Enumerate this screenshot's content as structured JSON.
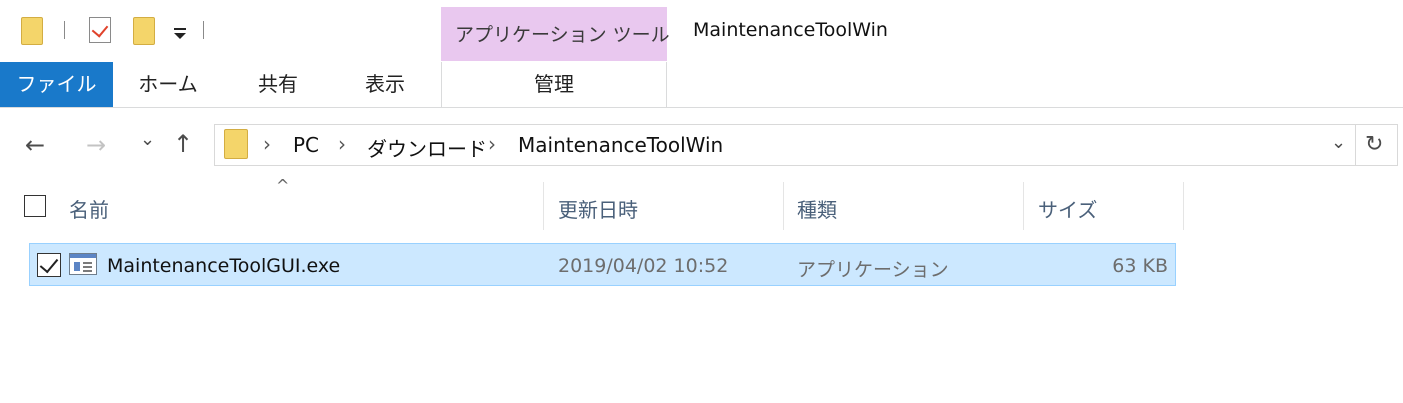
{
  "window": {
    "title": "MaintenanceToolWin",
    "tool_group_label": "アプリケーション ツール"
  },
  "quick_access": {
    "icons": [
      "folder-icon",
      "properties-icon",
      "new-folder-icon",
      "customize-menu-icon"
    ]
  },
  "ribbon": {
    "tabs": [
      {
        "label": "ファイル",
        "active": true
      },
      {
        "label": "ホーム"
      },
      {
        "label": "共有"
      },
      {
        "label": "表示"
      },
      {
        "label": "管理"
      }
    ]
  },
  "navigation": {
    "back_glyph": "←",
    "forward_glyph": "→",
    "recent_glyph": "⌄",
    "up_glyph": "↑",
    "breadcrumb": [
      "PC",
      "ダウンロード",
      "MaintenanceToolWin"
    ],
    "separator": "›",
    "dropdown_glyph": "⌄",
    "refresh_glyph": "↻"
  },
  "file_list": {
    "sort_indicator": "^",
    "columns": [
      "名前",
      "更新日時",
      "種類",
      "サイズ"
    ],
    "rows": [
      {
        "name": "MaintenanceToolGUI.exe",
        "modified": "2019/04/02 10:52",
        "type": "アプリケーション",
        "size": "63 KB",
        "selected": true
      }
    ]
  },
  "colors": {
    "file_tab_bg": "#1979ca",
    "tool_group_bg": "#e9c8ef",
    "selection_bg": "#cce8ff",
    "selection_border": "#99d1ff",
    "folder_yellow": "#f4d56a"
  }
}
